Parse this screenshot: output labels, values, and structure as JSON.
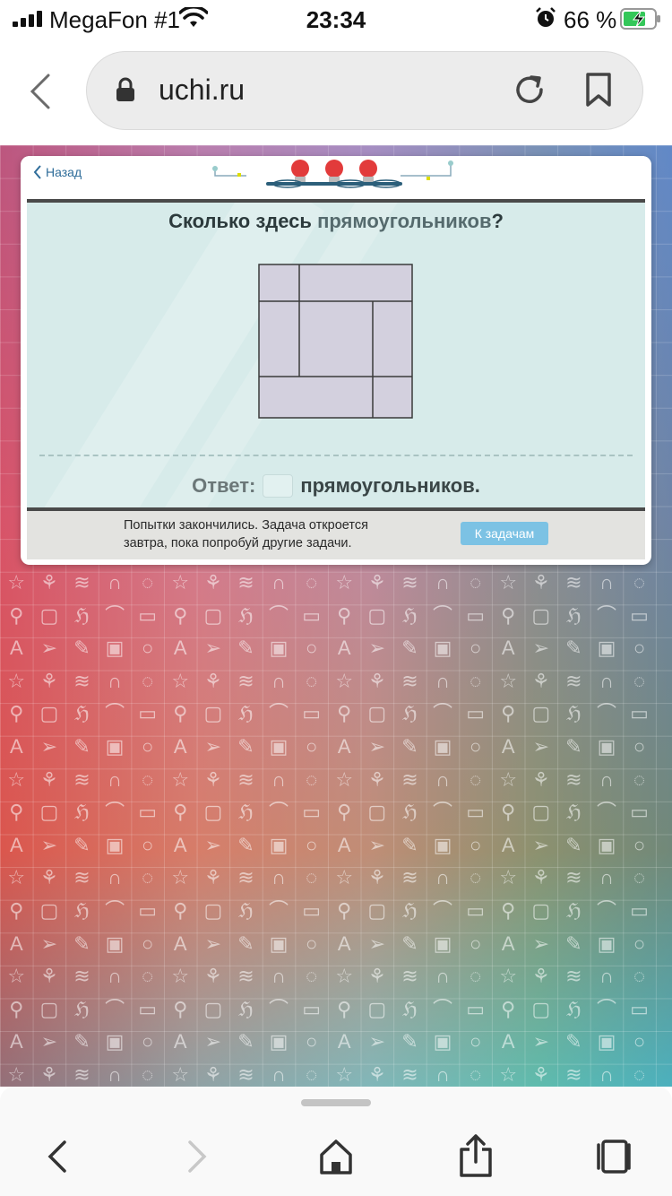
{
  "status_bar": {
    "carrier": "MegaFon #1",
    "time": "23:34",
    "battery_percent": "66 %",
    "icons": [
      "signal-icon",
      "wifi-icon",
      "alarm-icon",
      "battery-charging-icon"
    ]
  },
  "browser": {
    "url": "uchi.ru",
    "icons": [
      "back-arrow-icon",
      "lock-icon",
      "reload-icon",
      "bookmark-icon"
    ]
  },
  "card": {
    "back_label": "Назад",
    "question_prefix": "Сколько здесь ",
    "question_accent": "прямоугольников",
    "question_suffix": "?",
    "answer_label": "Ответ:",
    "answer_value": "",
    "answer_unit": "прямоугольников.",
    "footer_line1": "Попытки закончились. Задача откроется",
    "footer_line2": "завтра, пока попробуй другие задачи.",
    "to_tasks_button": "К задачам",
    "colors": {
      "panel": "#d7ebea",
      "button": "#7cc2e4",
      "figure_fill": "#d3d0de",
      "figure_stroke": "#3a3a3a"
    }
  },
  "toolbar": {
    "icons": [
      "back-icon",
      "forward-icon",
      "home-icon",
      "share-icon",
      "tabs-icon"
    ]
  }
}
